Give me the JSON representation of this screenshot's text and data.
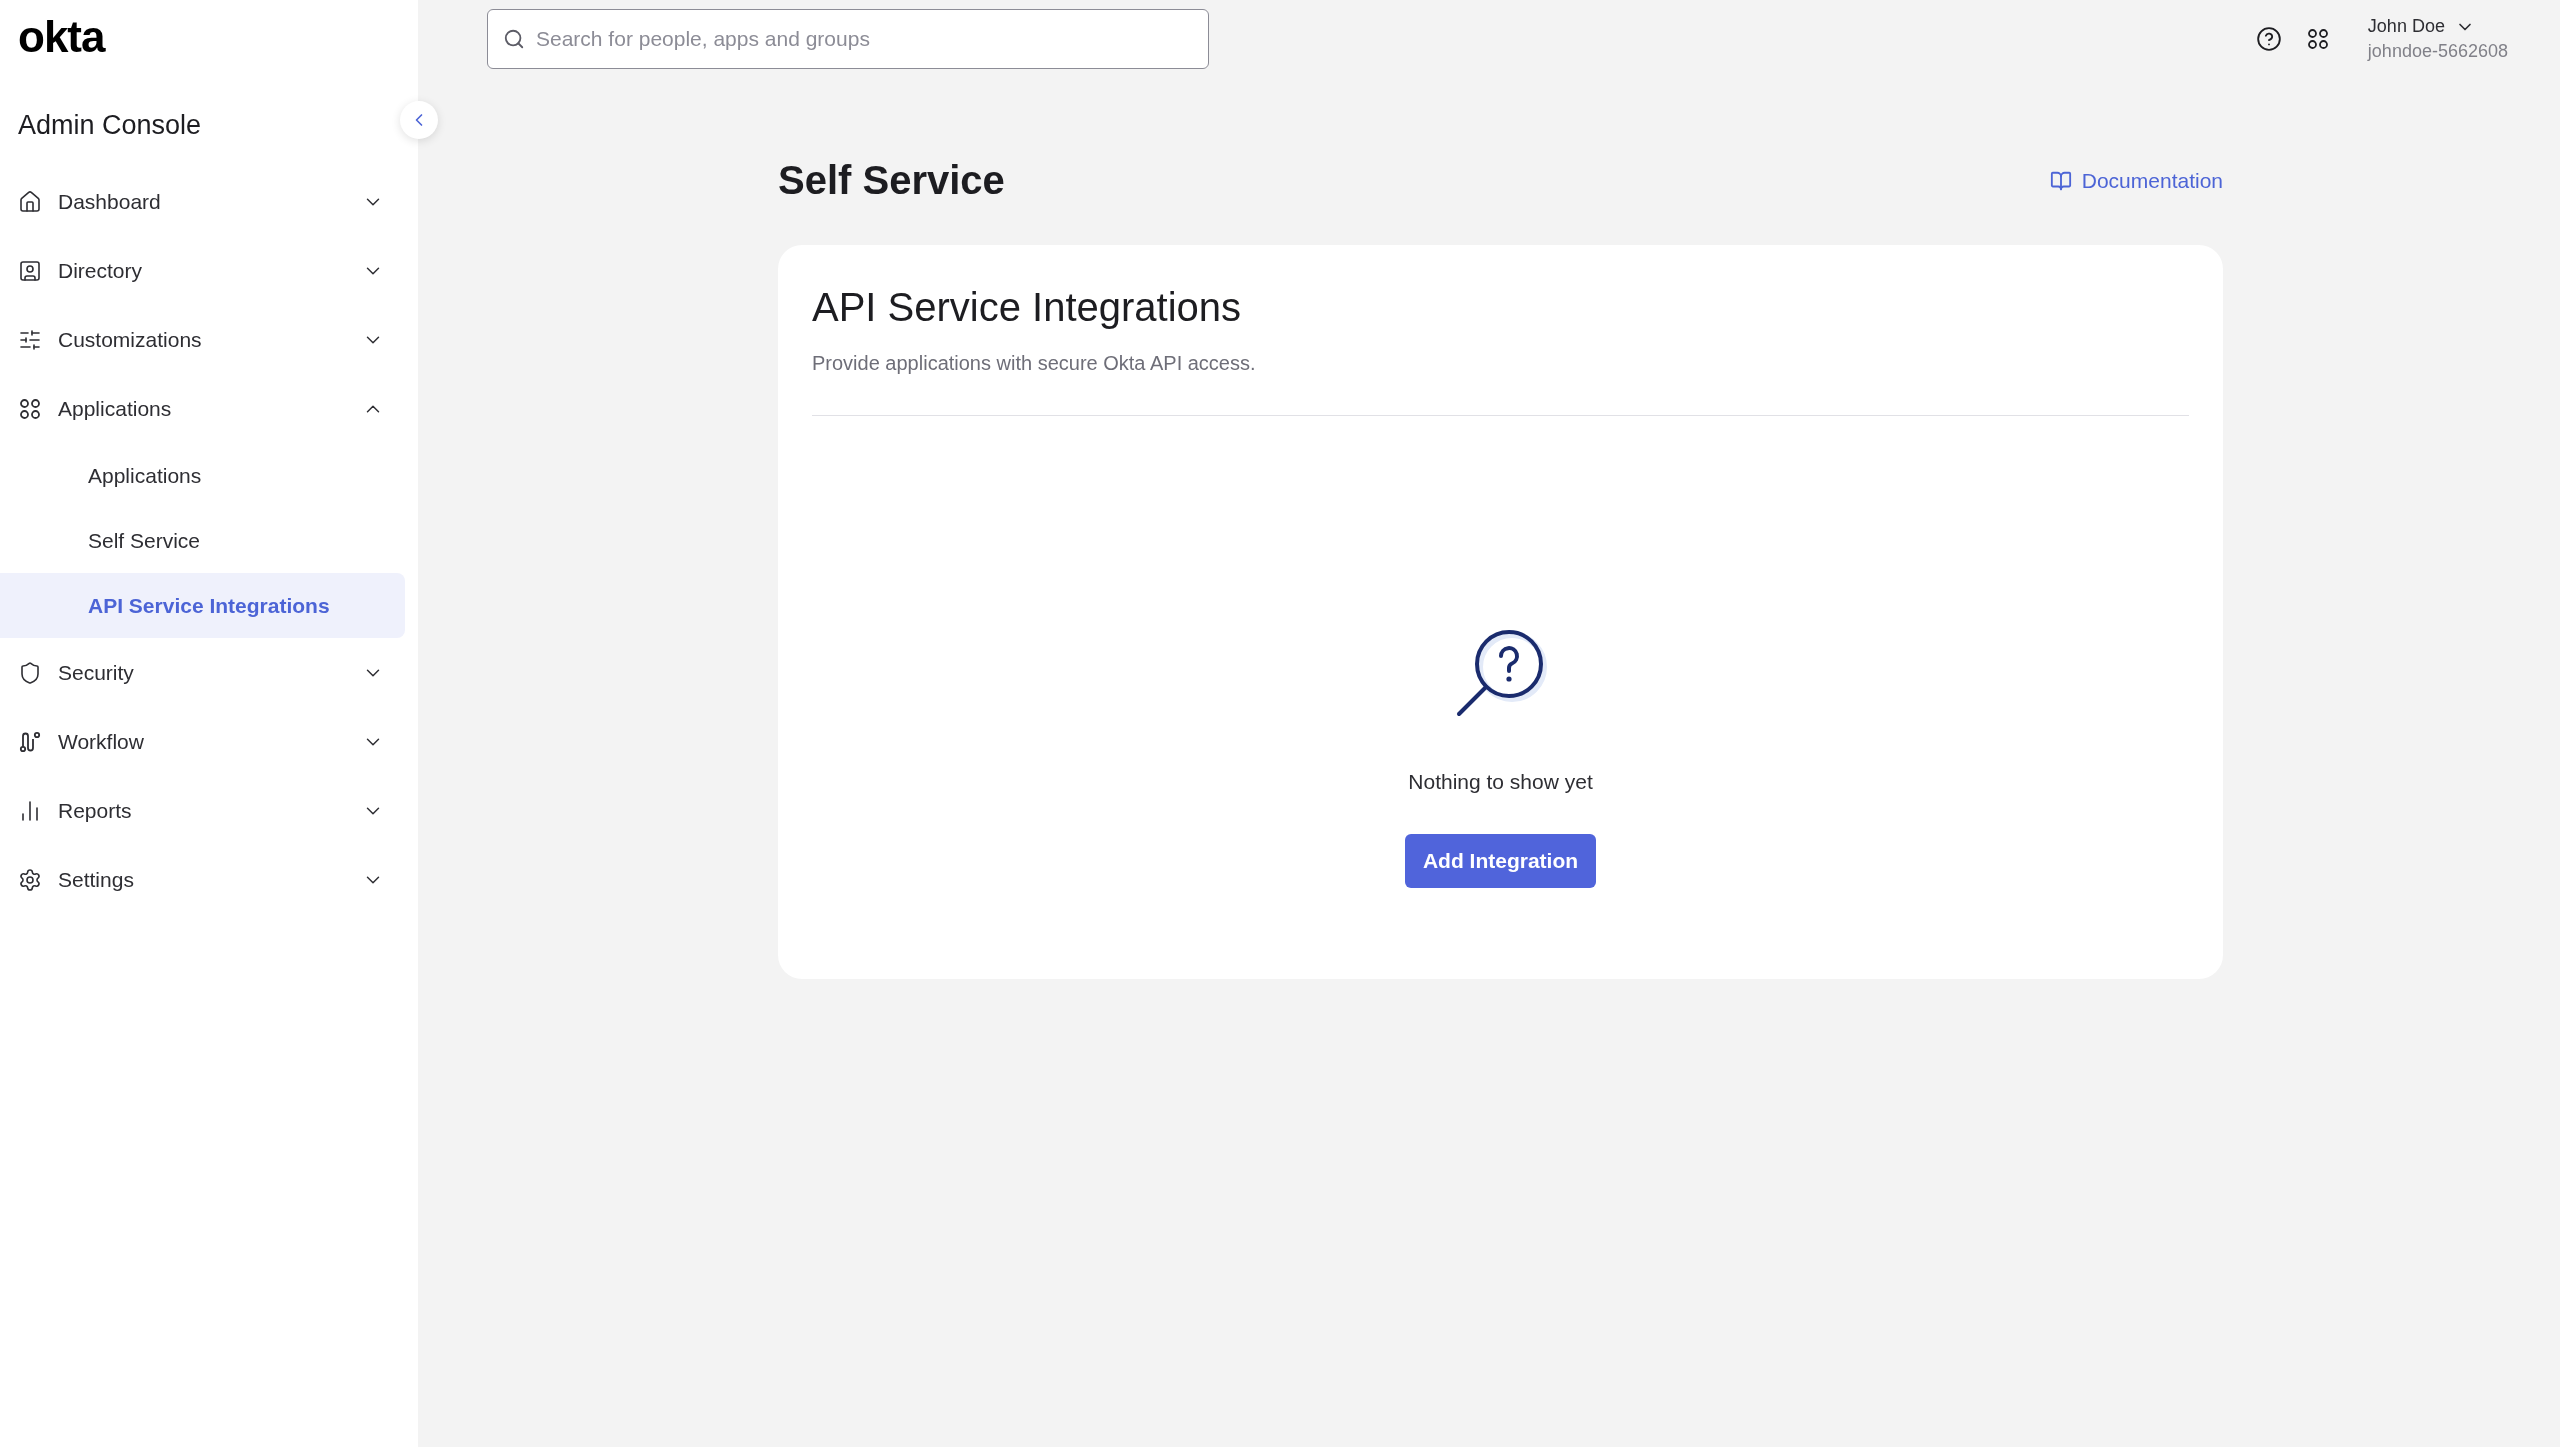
{
  "logo": "okta",
  "sidebar": {
    "title": "Admin Console",
    "items": [
      {
        "label": "Dashboard",
        "expanded": false
      },
      {
        "label": "Directory",
        "expanded": false
      },
      {
        "label": "Customizations",
        "expanded": false
      },
      {
        "label": "Applications",
        "expanded": true,
        "children": [
          {
            "label": "Applications",
            "selected": false
          },
          {
            "label": "Self Service",
            "selected": false
          },
          {
            "label": "API Service Integrations",
            "selected": true
          }
        ]
      },
      {
        "label": "Security",
        "expanded": false
      },
      {
        "label": "Workflow",
        "expanded": false
      },
      {
        "label": "Reports",
        "expanded": false
      },
      {
        "label": "Settings",
        "expanded": false
      }
    ]
  },
  "search": {
    "placeholder": "Search for people, apps and groups"
  },
  "user": {
    "name": "John Doe",
    "org": "johndoe-5662608"
  },
  "page": {
    "title": "Self Service",
    "doc_link": "Documentation"
  },
  "card": {
    "title": "API Service Integrations",
    "subtitle": "Provide applications with secure Okta API access.",
    "empty_text": "Nothing to show yet",
    "button": "Add Integration"
  }
}
